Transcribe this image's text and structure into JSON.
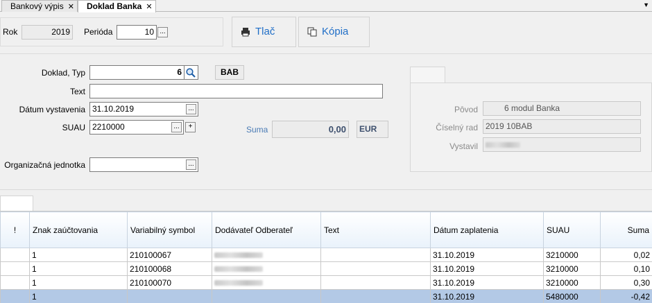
{
  "tabs": [
    {
      "label": "Bankový výpis"
    },
    {
      "label": "Doklad Banka"
    }
  ],
  "header": {
    "rok_label": "Rok",
    "rok_value": "2019",
    "perioda_label": "Perióda",
    "perioda_value": "10",
    "print_button": "Tlač",
    "copy_button": "Kópia"
  },
  "form": {
    "doklad_label": "Doklad, Typ",
    "doklad_value": "6",
    "typ_value": "BAB",
    "text_label": "Text",
    "text_value": "",
    "datum_label": "Dátum vystavenia",
    "datum_value": "31.10.2019",
    "suau_label": "SUAU",
    "suau_value": "2210000",
    "suma_label": "Suma",
    "suma_value": "0,00",
    "currency": "EUR",
    "org_label": "Organizačná jednotka",
    "org_value": ""
  },
  "info": {
    "povod_label": "Pôvod",
    "povod_value": "6 modul Banka",
    "rad_label": "Číselný rad",
    "rad_value": "2019  10BAB",
    "vystavil_label": "Vystavil"
  },
  "grid": {
    "columns": [
      "!",
      "Znak zaúčtovania",
      "Variabilný symbol",
      "Dodávateľ Odberateľ",
      "Text",
      "Dátum zaplatenia",
      "SUAU",
      "Suma"
    ],
    "rows": [
      {
        "flag": "",
        "znak": "1",
        "vs": "210100067",
        "text": "",
        "datum": "31.10.2019",
        "suau": "3210000",
        "suma": "0,02"
      },
      {
        "flag": "",
        "znak": "1",
        "vs": "210100068",
        "text": "",
        "datum": "31.10.2019",
        "suau": "3210000",
        "suma": "0,10"
      },
      {
        "flag": "",
        "znak": "1",
        "vs": "210100070",
        "text": "",
        "datum": "31.10.2019",
        "suau": "3210000",
        "suma": "0,30"
      },
      {
        "flag": "",
        "znak": "1",
        "vs": "",
        "text": "",
        "datum": "31.10.2019",
        "suau": "5480000",
        "suma": "-0,42"
      }
    ]
  }
}
